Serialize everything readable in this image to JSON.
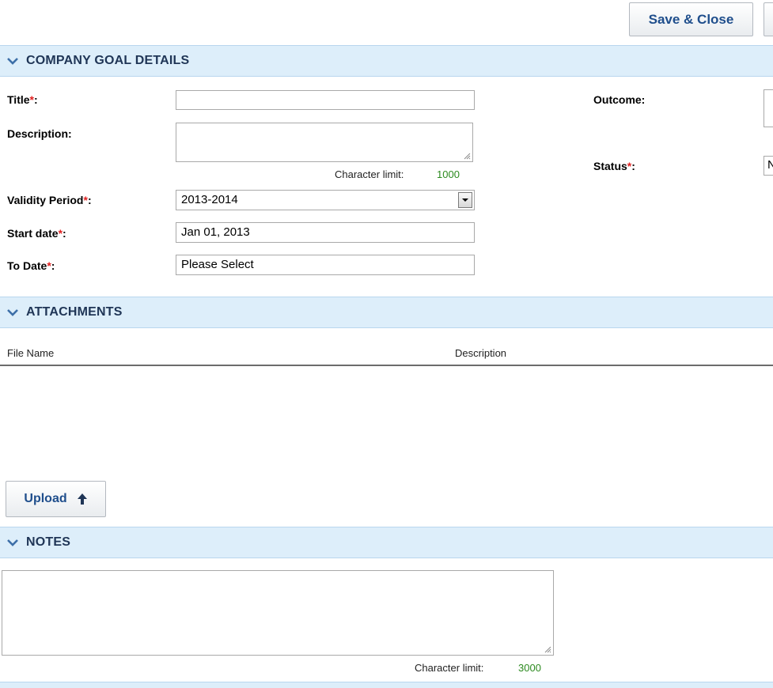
{
  "toolbar": {
    "save_close_label": "Save & Close"
  },
  "sections": {
    "details": "COMPANY GOAL DETAILS",
    "attachments": "ATTACHMENTS",
    "notes": "NOTES"
  },
  "form": {
    "title_label": "Title",
    "description_label": "Description:",
    "validity_label": "Validity Period",
    "validity_value": "2013-2014",
    "start_label": "Start date",
    "start_value": "Jan 01, 2013",
    "to_label": "To Date",
    "to_value": "Please Select",
    "outcome_label": "Outcome:",
    "status_label": "Status",
    "status_value": "N",
    "required_mark": "*",
    "colon": ":",
    "char_limit_label": "Character limit:",
    "char_limit_value": "1000"
  },
  "attachments": {
    "columns": [
      "File Name",
      "Description"
    ],
    "upload_label": "Upload"
  },
  "notes": {
    "char_limit_label": "Character limit:",
    "char_limit_value": "3000"
  },
  "colors": {
    "section_bg": "#ddeefa",
    "accent": "#1f4e8c",
    "required": "#e02020",
    "limit_green": "#2c8a1f"
  }
}
